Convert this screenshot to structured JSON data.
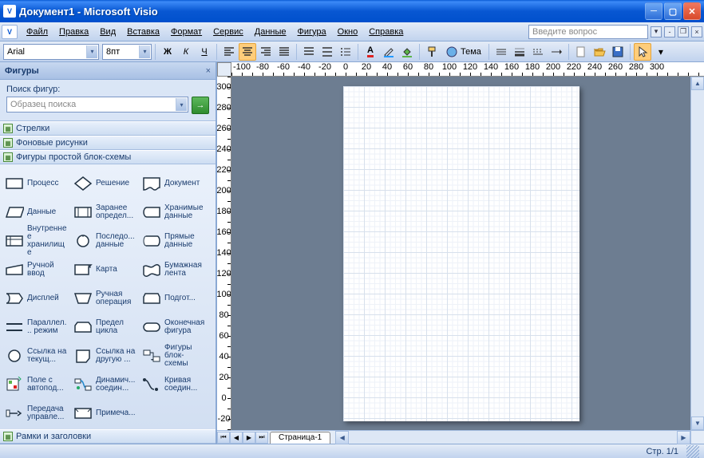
{
  "title": "Документ1 - Microsoft Visio",
  "menu": {
    "file": "Файл",
    "edit": "Правка",
    "view": "Вид",
    "insert": "Вставка",
    "format": "Формат",
    "service": "Сервис",
    "data": "Данные",
    "shape": "Фигура",
    "window": "Окно",
    "help": "Справка"
  },
  "askbox": "Введите вопрос",
  "font": {
    "name": "Arial",
    "size": "8пт"
  },
  "themeLabel": "Тема",
  "panel": {
    "title": "Фигуры",
    "searchLabel": "Поиск фигур:",
    "searchPlaceholder": "Образец поиска",
    "cats": [
      "Стрелки",
      "Фоновые рисунки",
      "Фигуры простой блок-схемы",
      "Рамки и заголовки"
    ],
    "shapes": [
      [
        "Процесс",
        "Решение",
        "Документ"
      ],
      [
        "Данные",
        "Заранее определ...",
        "Хранимые данные"
      ],
      [
        "Внутреннее хранилище",
        "Последо... данные",
        "Прямые данные"
      ],
      [
        "Ручной ввод",
        "Карта",
        "Бумажная лента"
      ],
      [
        "Дисплей",
        "Ручная операция",
        "Подгот..."
      ],
      [
        "Параллел... режим",
        "Предел цикла",
        "Оконечная фигура"
      ],
      [
        "Ссылка на текущ...",
        "Ссылка на другую ...",
        "Фигуры блок-схемы"
      ],
      [
        "Поле с автопод...",
        "Динамич... соедин...",
        "Кривая соедин..."
      ],
      [
        "Передача управле...",
        "Примеча...",
        ""
      ]
    ]
  },
  "rulerH": [
    "-100",
    "-80",
    "-60",
    "-40",
    "-20",
    "0",
    "20",
    "40",
    "60",
    "80",
    "100",
    "120",
    "140",
    "160",
    "180",
    "200",
    "220",
    "240",
    "260",
    "280",
    "300"
  ],
  "rulerV": [
    "300",
    "280",
    "260",
    "240",
    "220",
    "200",
    "180",
    "160",
    "140",
    "120",
    "100",
    "80",
    "60",
    "40",
    "20",
    "0",
    "-20"
  ],
  "pagetab": "Страница-1",
  "status": "Стр. 1/1"
}
